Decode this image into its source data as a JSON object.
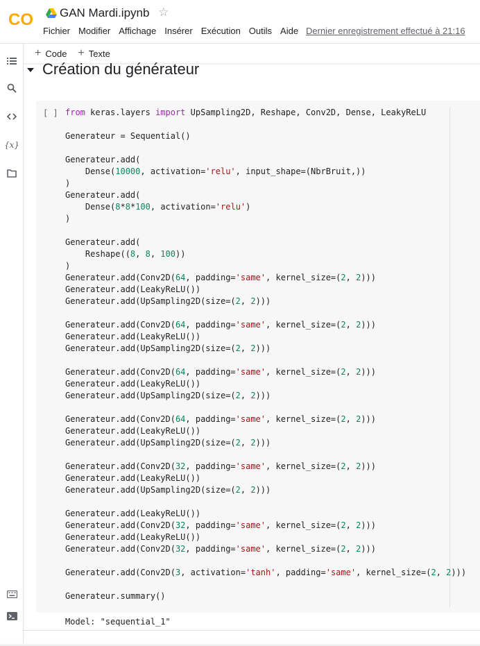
{
  "header": {
    "title": "GAN Mardi.ipynb",
    "star_icon": "star-outline-icon",
    "menu": [
      "Fichier",
      "Modifier",
      "Affichage",
      "Insérer",
      "Exécution",
      "Outils",
      "Aide"
    ],
    "save_status": "Dernier enregistrement effectué à 21:16"
  },
  "toolbar": {
    "add_code": "Code",
    "add_text": "Texte"
  },
  "sidebar": {
    "icons": [
      "toc-icon",
      "search-icon",
      "code-snippets-icon",
      "variables-icon",
      "files-icon",
      "command-palette-icon",
      "terminal-icon"
    ],
    "variables_label": "{x}"
  },
  "section": {
    "title": "Création du générateur"
  },
  "cell": {
    "run_label": "[ ]",
    "code_lines": [
      "from keras.layers import UpSampling2D, Reshape, Conv2D, Dense, LeakyReLU",
      "",
      "Generateur = Sequential()",
      "",
      "Generateur.add(",
      "    Dense(10000, activation='relu', input_shape=(NbrBruit,))",
      ")",
      "Generateur.add(",
      "    Dense(8*8*100, activation='relu')",
      ")",
      "",
      "Generateur.add(",
      "    Reshape((8, 8, 100))",
      ")",
      "Generateur.add(Conv2D(64, padding='same', kernel_size=(2, 2)))",
      "Generateur.add(LeakyReLU())",
      "Generateur.add(UpSampling2D(size=(2, 2)))",
      "",
      "Generateur.add(Conv2D(64, padding='same', kernel_size=(2, 2)))",
      "Generateur.add(LeakyReLU())",
      "Generateur.add(UpSampling2D(size=(2, 2)))",
      "",
      "Generateur.add(Conv2D(64, padding='same', kernel_size=(2, 2)))",
      "Generateur.add(LeakyReLU())",
      "Generateur.add(UpSampling2D(size=(2, 2)))",
      "",
      "Generateur.add(Conv2D(64, padding='same', kernel_size=(2, 2)))",
      "Generateur.add(LeakyReLU())",
      "Generateur.add(UpSampling2D(size=(2, 2)))",
      "",
      "Generateur.add(Conv2D(32, padding='same', kernel_size=(2, 2)))",
      "Generateur.add(LeakyReLU())",
      "Generateur.add(UpSampling2D(size=(2, 2)))",
      "",
      "Generateur.add(LeakyReLU())",
      "Generateur.add(Conv2D(32, padding='same', kernel_size=(2, 2)))",
      "Generateur.add(LeakyReLU())",
      "Generateur.add(Conv2D(32, padding='same', kernel_size=(2, 2)))",
      "",
      "Generateur.add(Conv2D(3, activation='tanh', padding='same', kernel_size=(2, 2)))",
      "",
      "Generateur.summary()"
    ],
    "output": "Model: \"sequential_1\""
  },
  "colors": {
    "keyword": "#9c27b0",
    "string": "#a31515",
    "number": "#098658",
    "logo_orange": "#f9ab00",
    "logo_dark_orange": "#e8710a"
  }
}
